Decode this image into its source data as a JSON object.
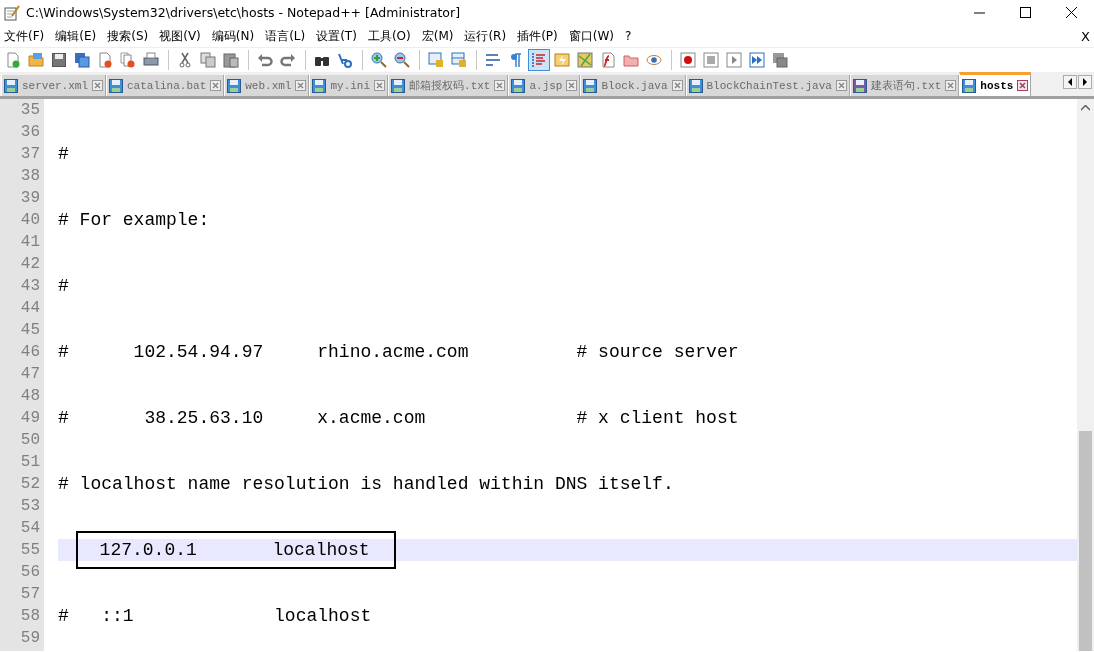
{
  "window": {
    "title": "C:\\Windows\\System32\\drivers\\etc\\hosts - Notepad++ [Administrator]"
  },
  "menu": {
    "items": [
      "文件(F)",
      "编辑(E)",
      "搜索(S)",
      "视图(V)",
      "编码(N)",
      "语言(L)",
      "设置(T)",
      "工具(O)",
      "宏(M)",
      "运行(R)",
      "插件(P)",
      "窗口(W)",
      "?"
    ],
    "close_label": "X"
  },
  "toolbar": [
    {
      "kind": "new",
      "on": false
    },
    {
      "kind": "open",
      "on": false
    },
    {
      "kind": "save",
      "on": false
    },
    {
      "kind": "save-all",
      "on": false
    },
    {
      "kind": "close",
      "on": false
    },
    {
      "kind": "close-all",
      "on": false
    },
    {
      "kind": "print",
      "on": false
    },
    {
      "kind": "sep"
    },
    {
      "kind": "cut",
      "on": false
    },
    {
      "kind": "copy",
      "on": false
    },
    {
      "kind": "paste",
      "on": false
    },
    {
      "kind": "sep"
    },
    {
      "kind": "undo",
      "on": false
    },
    {
      "kind": "redo",
      "on": false
    },
    {
      "kind": "sep"
    },
    {
      "kind": "find",
      "on": false
    },
    {
      "kind": "replace",
      "on": false
    },
    {
      "kind": "sep"
    },
    {
      "kind": "zoom-in",
      "on": false
    },
    {
      "kind": "zoom-out",
      "on": false
    },
    {
      "kind": "sep"
    },
    {
      "kind": "sync-v",
      "on": false
    },
    {
      "kind": "sync-h",
      "on": false
    },
    {
      "kind": "sep"
    },
    {
      "kind": "wrap",
      "on": false
    },
    {
      "kind": "pilcrow",
      "on": false
    },
    {
      "kind": "indent",
      "on": true
    },
    {
      "kind": "lang",
      "on": false
    },
    {
      "kind": "map",
      "on": false
    },
    {
      "kind": "func",
      "on": false
    },
    {
      "kind": "folder",
      "on": false
    },
    {
      "kind": "eye",
      "on": false
    },
    {
      "kind": "sep"
    },
    {
      "kind": "record",
      "on": false
    },
    {
      "kind": "stop",
      "on": false
    },
    {
      "kind": "play",
      "on": false
    },
    {
      "kind": "play-multi",
      "on": false
    },
    {
      "kind": "save-macro",
      "on": false
    }
  ],
  "tabs": [
    {
      "label": "server.xml",
      "selected": false,
      "color": "#3c8fd8"
    },
    {
      "label": "catalina.bat",
      "selected": false,
      "color": "#3c8fd8"
    },
    {
      "label": "web.xml",
      "selected": false,
      "color": "#3c8fd8"
    },
    {
      "label": "my.ini",
      "selected": false,
      "color": "#3c8fd8"
    },
    {
      "label": "邮箱授权码.txt",
      "selected": false,
      "color": "#3c8fd8"
    },
    {
      "label": "a.jsp",
      "selected": false,
      "color": "#3c8fd8"
    },
    {
      "label": "Block.java",
      "selected": false,
      "color": "#3c8fd8"
    },
    {
      "label": "BlockChainTest.java",
      "selected": false,
      "color": "#3c8fd8"
    },
    {
      "label": "建表语句.txt",
      "selected": false,
      "color": "#7a5aa0"
    },
    {
      "label": "hosts",
      "selected": true,
      "color": "#3c8fd8"
    }
  ],
  "editor": {
    "lines": [
      {
        "number": "35",
        "current": false,
        "boxed": false
      },
      {
        "number": "36",
        "current": false,
        "boxed": false
      },
      {
        "number": "37",
        "text": "#",
        "current": false,
        "boxed": false
      },
      {
        "number": "38",
        "current": false,
        "boxed": false
      },
      {
        "number": "39",
        "current": false,
        "boxed": false
      },
      {
        "number": "40",
        "text": "# For example:",
        "current": false,
        "boxed": false
      },
      {
        "number": "41",
        "current": false,
        "boxed": false
      },
      {
        "number": "42",
        "current": false,
        "boxed": false
      },
      {
        "number": "43",
        "text": "#",
        "current": false,
        "boxed": false
      },
      {
        "number": "44",
        "current": false,
        "boxed": false
      },
      {
        "number": "45",
        "current": false,
        "boxed": false
      },
      {
        "number": "46",
        "text": "#      102.54.94.97     rhino.acme.com          # source server",
        "current": false,
        "boxed": false
      },
      {
        "number": "47",
        "current": false,
        "boxed": false
      },
      {
        "number": "48",
        "current": false,
        "boxed": false
      },
      {
        "number": "49",
        "text": "#       38.25.63.10     x.acme.com              # x client host",
        "current": false,
        "boxed": false
      },
      {
        "number": "50",
        "current": false,
        "boxed": false
      },
      {
        "number": "51",
        "current": false,
        "boxed": false
      },
      {
        "number": "52",
        "text": "# localhost name resolution is handled within DNS itself.",
        "current": false,
        "boxed": false
      },
      {
        "number": "53",
        "current": false,
        "boxed": false
      },
      {
        "number": "54",
        "current": false,
        "boxed": false
      },
      {
        "number": "55",
        "text": "    127.0.0.1       localhost",
        "current": true,
        "boxed": true
      },
      {
        "number": "56",
        "current": false,
        "boxed": false
      },
      {
        "number": "57",
        "current": false,
        "boxed": false
      },
      {
        "number": "58",
        "text": "#   ::1             localhost",
        "current": false,
        "boxed": false
      },
      {
        "number": "59",
        "current": false,
        "boxed": false
      }
    ]
  }
}
